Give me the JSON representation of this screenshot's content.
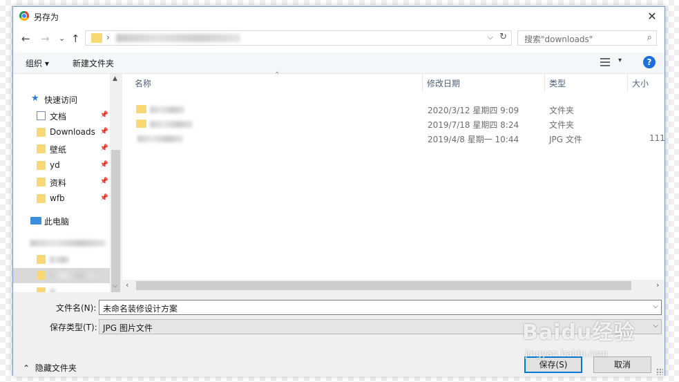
{
  "window": {
    "title": "另存为"
  },
  "nav": {
    "back": "←",
    "forward": "→",
    "recent": "⌄",
    "up": "↑",
    "address_sep": "›",
    "dropdown": "⌵",
    "refresh": "↻"
  },
  "search": {
    "placeholder": "搜索\"downloads\"",
    "icon": "⌕"
  },
  "toolbar": {
    "organize": "组织 ▾",
    "new_folder": "新建文件夹",
    "view_dd": "▾",
    "help": "?"
  },
  "sidebar": {
    "quick_access": "快速访问",
    "items": [
      {
        "label": "文档",
        "icon": "document-icon",
        "pinned": true
      },
      {
        "label": "Downloads",
        "icon": "folder-icon",
        "pinned": true
      },
      {
        "label": "壁纸",
        "icon": "folder-icon",
        "pinned": true
      },
      {
        "label": "yd",
        "icon": "folder-icon",
        "pinned": true
      },
      {
        "label": "资料",
        "icon": "folder-icon",
        "pinned": true
      },
      {
        "label": "wfb",
        "icon": "folder-icon",
        "pinned": true
      }
    ],
    "this_pc": "此电脑",
    "pin_glyph": "📌"
  },
  "columns": {
    "name": "名称",
    "date": "修改日期",
    "type": "类型",
    "size": "大小"
  },
  "files": [
    {
      "date": "2020/3/12 星期四 9:09",
      "type": "文件夹",
      "size": ""
    },
    {
      "date": "2019/7/18 星期四 8:24",
      "type": "文件夹",
      "size": ""
    },
    {
      "date": "2019/4/8 星期一 10:44",
      "type": "JPG 文件",
      "size": "111"
    }
  ],
  "form": {
    "filename_label": "文件名(N):",
    "filename_value": "未命名装修设计方案",
    "type_label": "保存类型(T):",
    "type_value": "JPG 图片文件",
    "dd": "⌵"
  },
  "footer": {
    "hide_folders": "隐藏文件夹",
    "hide_icon": "⌃",
    "save": "保存(S)",
    "cancel": "取消"
  },
  "watermark": {
    "text": "Baidu经验",
    "url": "jingyan.baidu.com"
  }
}
